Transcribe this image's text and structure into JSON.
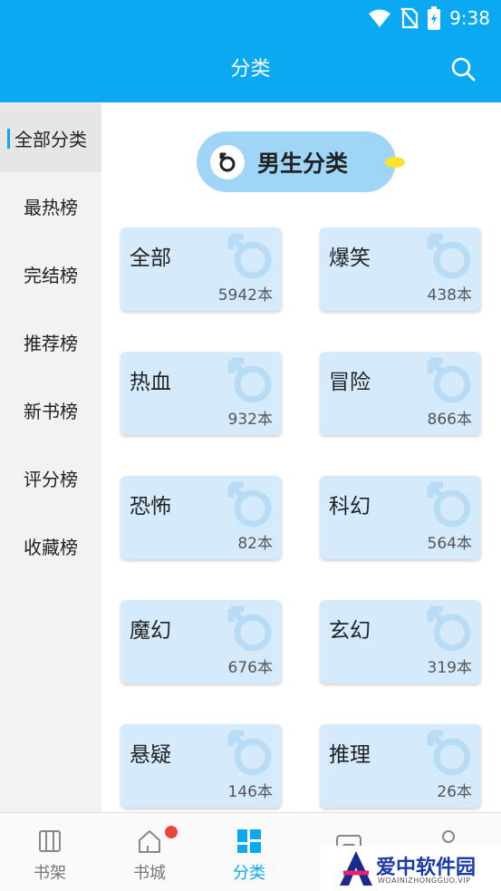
{
  "status": {
    "time": "9:38"
  },
  "header": {
    "title": "分类"
  },
  "sidebar": {
    "items": [
      {
        "label": "全部分类",
        "active": true
      },
      {
        "label": "最热榜"
      },
      {
        "label": "完结榜"
      },
      {
        "label": "推荐榜"
      },
      {
        "label": "新书榜"
      },
      {
        "label": "评分榜"
      },
      {
        "label": "收藏榜"
      }
    ]
  },
  "section": {
    "title": "男生分类",
    "icon": "male-icon"
  },
  "categories": [
    {
      "name": "全部",
      "count": "5942本"
    },
    {
      "name": "爆笑",
      "count": "438本"
    },
    {
      "name": "热血",
      "count": "932本"
    },
    {
      "name": "冒险",
      "count": "866本"
    },
    {
      "name": "恐怖",
      "count": "82本"
    },
    {
      "name": "科幻",
      "count": "564本"
    },
    {
      "name": "魔幻",
      "count": "676本"
    },
    {
      "name": "玄幻",
      "count": "319本"
    },
    {
      "name": "悬疑",
      "count": "146本"
    },
    {
      "name": "推理",
      "count": "26本"
    }
  ],
  "bottom_nav": [
    {
      "label": "书架",
      "icon": "bookshelf-icon"
    },
    {
      "label": "书城",
      "icon": "home-icon",
      "badge": true
    },
    {
      "label": "分类",
      "icon": "category-icon",
      "active": true
    },
    {
      "label": "",
      "icon": "game-icon"
    },
    {
      "label": "",
      "icon": "profile-icon"
    }
  ],
  "watermark": {
    "text": "爱中软件园",
    "sub": "WOAINIZHONGGUO.VIP"
  },
  "colors": {
    "accent": "#0aa9f2",
    "card": "#d5ebfc",
    "pill": "#9fd6f8"
  }
}
